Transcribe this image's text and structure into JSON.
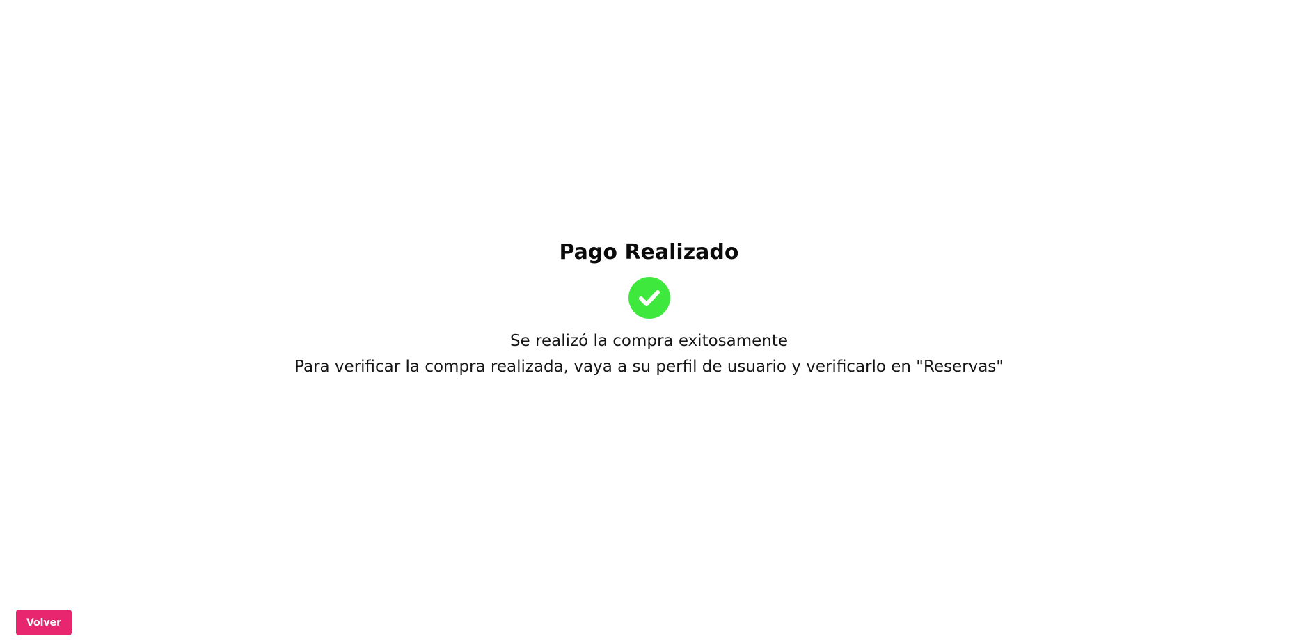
{
  "confirmation": {
    "title": "Pago Realizado",
    "icon": "check-circle-icon",
    "icon_color": "#3fe83c",
    "message_line1": "Se realizó la compra exitosamente",
    "message_line2": "Para verificar la compra realizada, vaya a su perfil de usuario y verificarlo en \"Reservas\""
  },
  "actions": {
    "back_label": "Volver",
    "back_color": "#e8266f"
  }
}
